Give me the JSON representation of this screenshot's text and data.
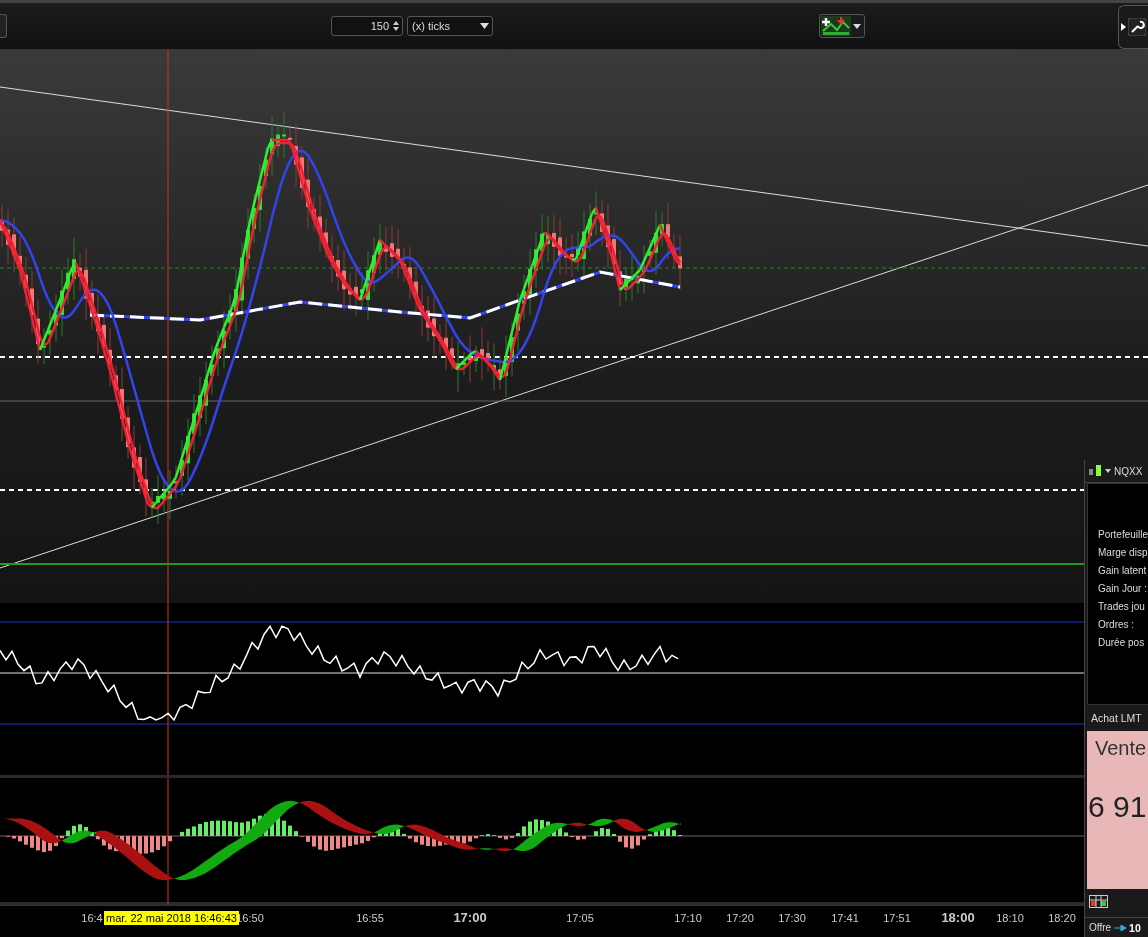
{
  "toolbar": {
    "bar_count": "150",
    "unit": "(x) ticks"
  },
  "crosshair": {
    "timestamp": "mar. 22 mai 2018 16:46:43"
  },
  "time_axis": [
    {
      "label": "16:4",
      "major": false
    },
    {
      "label": "16:50",
      "major": false
    },
    {
      "label": "16:55",
      "major": false
    },
    {
      "label": "17:00",
      "major": true
    },
    {
      "label": "17:05",
      "major": false
    },
    {
      "label": "17:10",
      "major": false
    },
    {
      "label": "17:20",
      "major": false
    },
    {
      "label": "17:30",
      "major": false
    },
    {
      "label": "17:41",
      "major": false
    },
    {
      "label": "17:51",
      "major": false
    },
    {
      "label": "18:00",
      "major": true
    },
    {
      "label": "18:10",
      "major": false
    },
    {
      "label": "18:20",
      "major": false
    }
  ],
  "order_panel": {
    "instrument": "NQXX",
    "account_rows": [
      "Portefeuille",
      "Marge disp",
      "Gain latent",
      "Gain Jour :",
      "Trades jou",
      "Ordres :",
      "Durée pos"
    ],
    "order_type": "Achat LMT",
    "side": "Vente",
    "price": "6 91",
    "offer_label": "Offre",
    "offer_size": "10"
  }
}
